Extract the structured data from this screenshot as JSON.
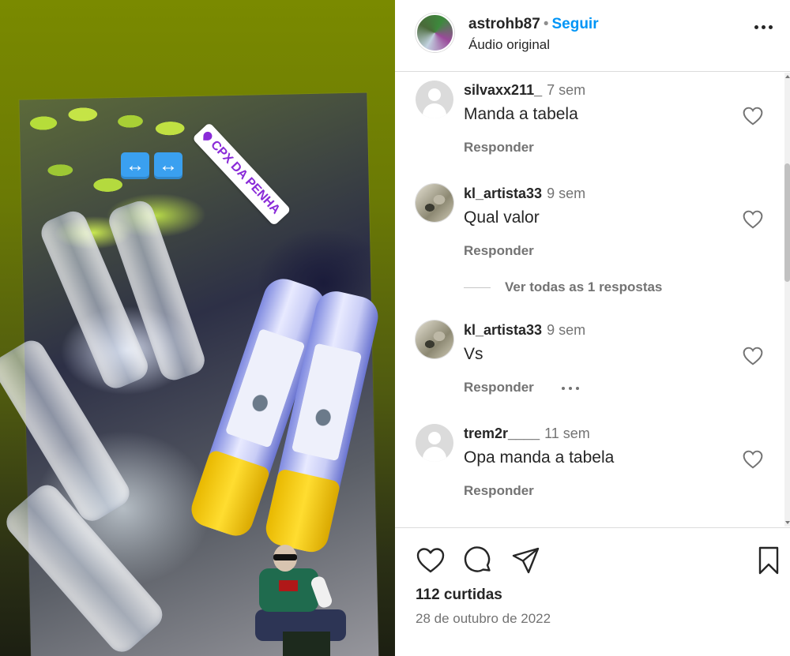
{
  "post": {
    "username": "astrohb87",
    "separator": "•",
    "follow_label": "Seguir",
    "audio_label": "Áudio original",
    "more_icon": "more-horizontal-icon",
    "media": {
      "location_sticker": "CPX DA PENHA",
      "arrow_emoji": "↔"
    }
  },
  "comments": [
    {
      "username": "silvaxx211_",
      "time": "7 sem",
      "text": "Manda a tabela",
      "reply_label": "Responder",
      "avatar": "default"
    },
    {
      "username": "kl_artista33",
      "time": "9 sem",
      "text": "Qual valor",
      "reply_label": "Responder",
      "avatar": "photo",
      "view_replies": "Ver todas as 1 respostas"
    },
    {
      "username": "kl_artista33",
      "time": "9 sem",
      "text": "Vs",
      "reply_label": "Responder",
      "avatar": "photo"
    },
    {
      "username": "trem2r____",
      "time": "11 sem",
      "text": "Opa manda a tabela",
      "reply_label": "Responder",
      "avatar": "default"
    }
  ],
  "footer": {
    "likes": "112 curtidas",
    "date": "28 de outubro de 2022"
  },
  "colors": {
    "accent": "#0095f6",
    "text": "#262626",
    "secondary": "#737373",
    "border": "#dbdbdb"
  }
}
